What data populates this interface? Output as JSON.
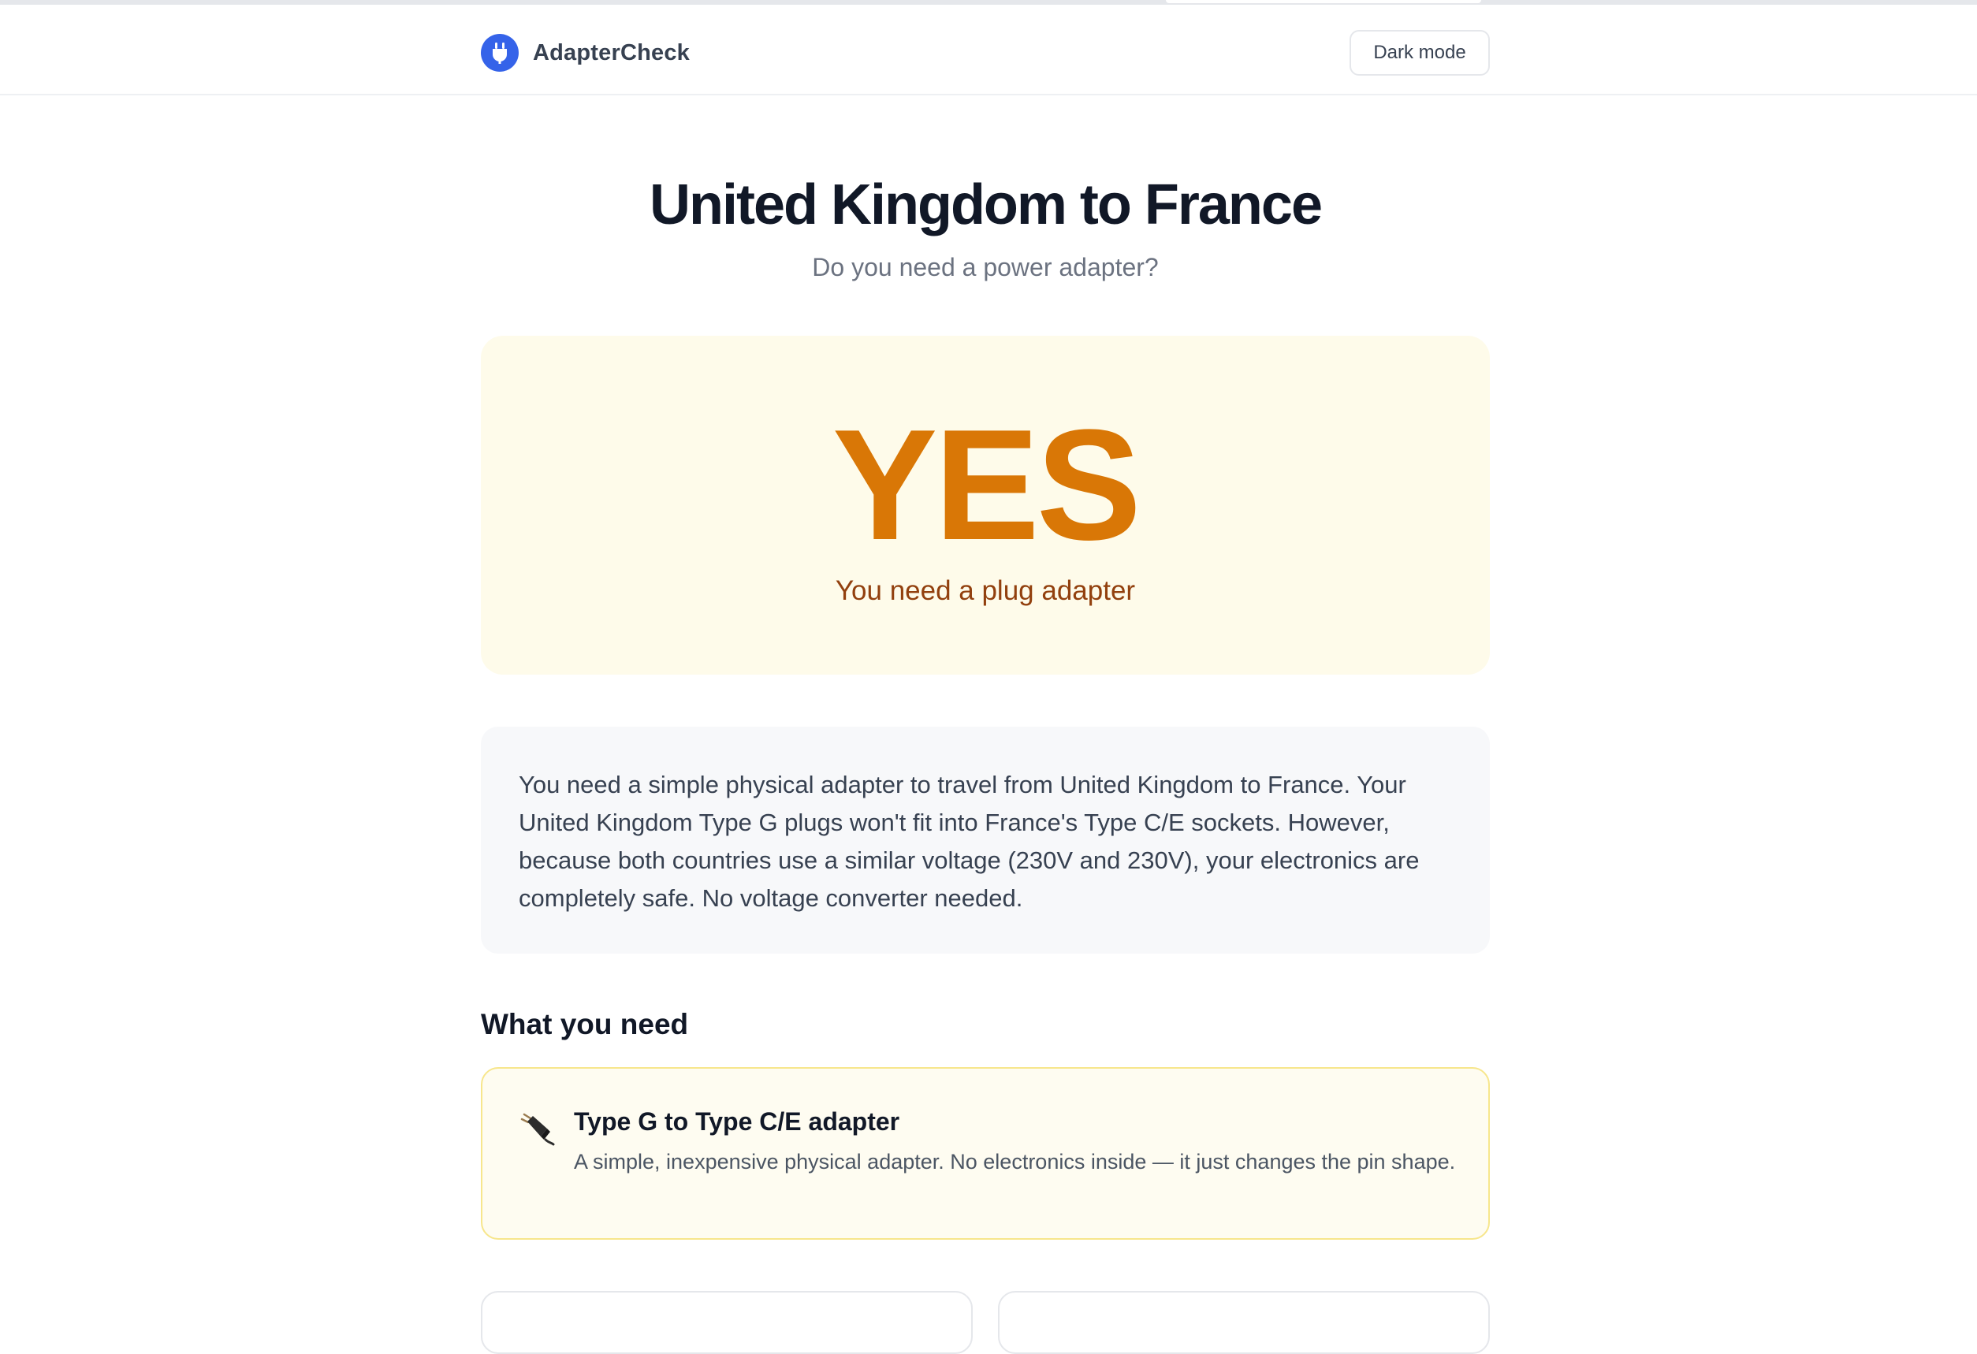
{
  "app": {
    "brand_name": "AdapterCheck",
    "dark_mode_label": "Dark mode"
  },
  "hero": {
    "title": "United Kingdom to France",
    "subtitle": "Do you need a power adapter?"
  },
  "verdict": {
    "answer": "YES",
    "summary": "You need a plug adapter"
  },
  "explanation": {
    "text": "You need a simple physical adapter to travel from United Kingdom to France. Your United Kingdom Type G plugs won't fit into France's Type C/E sockets. However, because both countries use a similar voltage (230V and 230V), your electronics are completely safe. No voltage converter needed."
  },
  "what_you_need": {
    "heading": "What you need",
    "items": [
      {
        "icon": "electric-plug-icon",
        "title": "Type G to Type C/E adapter",
        "description": "A simple, inexpensive physical adapter. No electronics inside — it just changes the pin shape."
      }
    ]
  },
  "colors": {
    "brand_blue": "#3563e9",
    "verdict_orange": "#d97706",
    "verdict_text_brown": "#92400e",
    "verdict_bg": "#fefbea",
    "need_card_border": "#f7e68c"
  }
}
